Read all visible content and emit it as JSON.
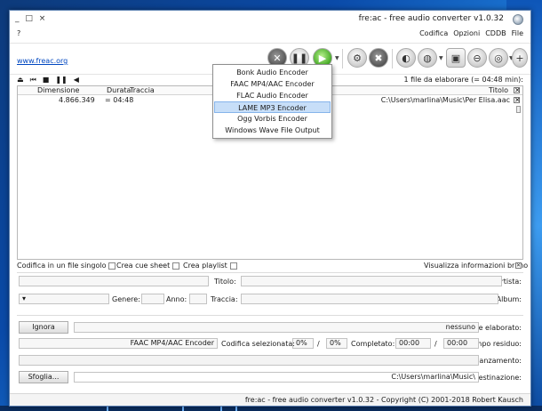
{
  "window": {
    "title": "fre:ac - free audio converter v1.0.32",
    "controls": "_ □ ×"
  },
  "menu": {
    "items": [
      "File",
      "CDDB",
      "Opzioni",
      "Codifica"
    ],
    "help": "?"
  },
  "toolbar": {
    "link": "www.freac.org",
    "encoder_menu": [
      "Bonk Audio Encoder",
      "FAAC MP4/AAC Encoder",
      "FLAC Audio Encoder",
      "LAME MP3 Encoder",
      "Ogg Vorbis Encoder",
      "Windows Wave File Output"
    ],
    "encoder_selected": "LAME MP3 Encoder"
  },
  "tracklist": {
    "count_label": "1 file da elaborare (= 04:48 min):",
    "columns": [
      "Titolo",
      "Traccia",
      "Durata",
      "Dimensione"
    ],
    "rows": [
      {
        "title": "C:\\Users\\marlina\\Music\\Per Elisa.aac",
        "track": "",
        "duration": "= 04:48",
        "size": "4.866.349"
      }
    ]
  },
  "options": {
    "single_file": "Codifica in un file singolo",
    "cue_sheet": "Crea cue sheet",
    "playlist": "Crea playlist"
  },
  "info": {
    "toggle_label": "Visualizza informazioni brano",
    "artist": "Artista:",
    "title": "Titolo:",
    "album": "Album:",
    "track": "Traccia:",
    "year": "Anno:",
    "genre": "Genere:"
  },
  "progress": {
    "file_label": "File elaborato:",
    "file_value": "nessuno",
    "ignore_button": "Ignora",
    "time_label": "Tempo residuo:",
    "time_value": "00:00",
    "slash": "/",
    "time_total": "00:00",
    "completed_label": "Completato:",
    "pct1": "0%",
    "pct2": "0%",
    "codec_label": "Codifica selezionata:",
    "codec_value": "FAAC MP4/AAC Encoder",
    "advance_label": "Avanzamento:",
    "advance_fraction": 0,
    "dest_label": "Destinazione:",
    "dest_value": "C:\\Users\\marlina\\Music\\",
    "browse_button": "Sfoglia..."
  },
  "status": {
    "text": "fre:ac - free audio converter v1.0.32 - Copyright (C) 2001-2018 Robert Kausch"
  }
}
